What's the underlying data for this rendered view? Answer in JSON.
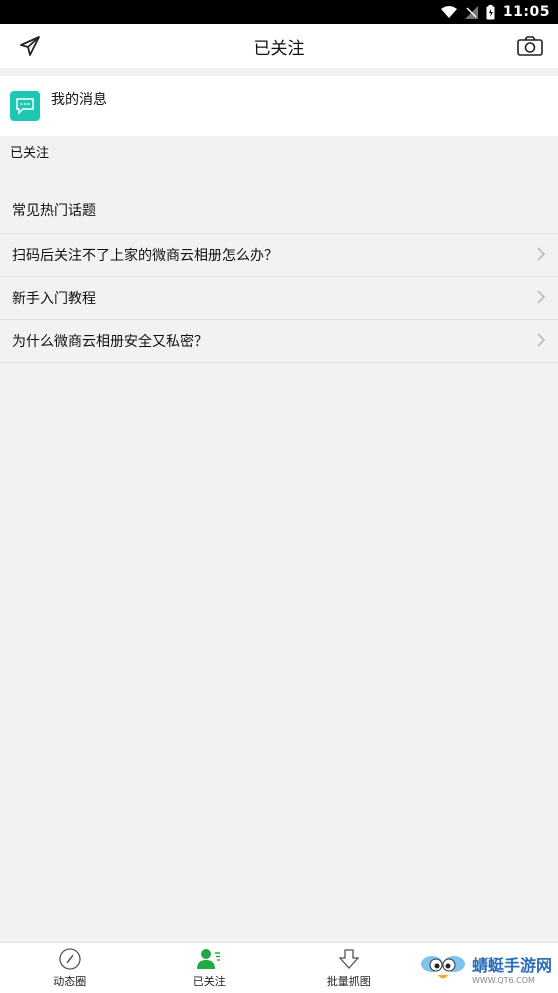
{
  "status_bar": {
    "time": "11:05"
  },
  "app_bar": {
    "title": "已关注",
    "left_icon": "send-icon",
    "right_icon": "camera-icon"
  },
  "messages": {
    "label": "我的消息",
    "icon": "chat-bubble-icon",
    "accent": "#1ec7b3"
  },
  "followed": {
    "label": "已关注"
  },
  "topics": {
    "title": "常见热门话题",
    "items": [
      {
        "label": "扫码后关注不了上家的微商云相册怎么办？"
      },
      {
        "label": "新手入门教程"
      },
      {
        "label": "为什么微商云相册安全又私密？"
      }
    ]
  },
  "bottom_nav": {
    "tabs": [
      {
        "label": "动态圈",
        "icon": "compass-icon"
      },
      {
        "label": "已关注",
        "icon": "person-icon",
        "active_color": "#22a845"
      },
      {
        "label": "批量抓图",
        "icon": "download-icon"
      },
      {
        "label": "",
        "icon": "profile-icon"
      }
    ]
  },
  "watermark": {
    "text": "蜻蜓手游网",
    "sub": "WWW.QT6.COM"
  }
}
